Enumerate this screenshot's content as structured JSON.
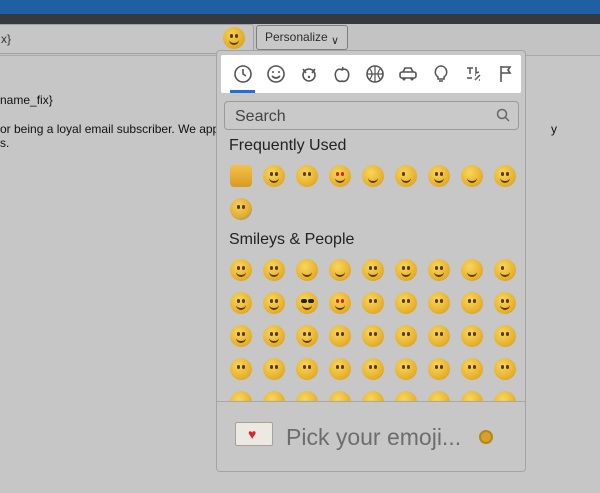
{
  "compose": {
    "subject_value": "x}",
    "personalize_label": "Personalize",
    "body_line1": "name_fix}",
    "body_line2": "or being a loyal email subscriber. We app",
    "body_line3": "s."
  },
  "picker": {
    "categories": [
      {
        "name": "recent",
        "icon": "clock-icon"
      },
      {
        "name": "smileys",
        "icon": "smiley-icon"
      },
      {
        "name": "animals",
        "icon": "dog-icon"
      },
      {
        "name": "food",
        "icon": "apple-icon"
      },
      {
        "name": "activity",
        "icon": "basketball-icon"
      },
      {
        "name": "travel",
        "icon": "car-icon"
      },
      {
        "name": "objects",
        "icon": "lightbulb-icon"
      },
      {
        "name": "symbols",
        "icon": "symbols-icon"
      },
      {
        "name": "flags",
        "icon": "flag-icon"
      }
    ],
    "search_placeholder": "Search",
    "frequently_used_title": "Frequently Used",
    "smileys_title": "Smileys & People",
    "footer_text": "Pick your emoji..."
  }
}
